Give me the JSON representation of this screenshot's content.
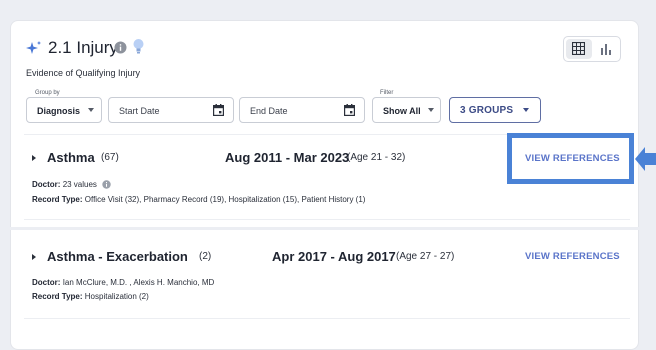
{
  "header": {
    "title": "2.1 Injury",
    "subtitle": "Evidence of Qualifying Injury"
  },
  "filters": {
    "group_by_label": "Group by",
    "group_by_value": "Diagnosis",
    "start_date_placeholder": "Start Date",
    "end_date_placeholder": "End Date",
    "filter_label": "Filter",
    "filter_value": "Show All",
    "groups_button": "3 GROUPS"
  },
  "records": [
    {
      "name": "Asthma",
      "count": "(67)",
      "dates": "Aug 2011 - Mar 2023",
      "age": "(Age 21 - 32)",
      "view_label": "VIEW REFERENCES",
      "doctor_label": "Doctor:",
      "doctor_value": "23 values",
      "record_type_label": "Record Type:",
      "record_type_value": "Office Visit (32),  Pharmacy Record (19),  Hospitalization (15),  Patient History (1)"
    },
    {
      "name": "Asthma - Exacerbation",
      "count": "(2)",
      "dates": "Apr 2017 - Aug 2017",
      "age": "(Age 27 - 27)",
      "view_label": "VIEW REFERENCES",
      "doctor_label": "Doctor:",
      "doctor_value": "Ian McClure, M.D. ,   Alexis H. Manchio, MD",
      "record_type_label": "Record Type:",
      "record_type_value": "Hospitalization (2)"
    }
  ],
  "colors": {
    "accent": "#5a74c9",
    "highlight": "#4a82d6",
    "groups_border": "#5f6ea3"
  }
}
